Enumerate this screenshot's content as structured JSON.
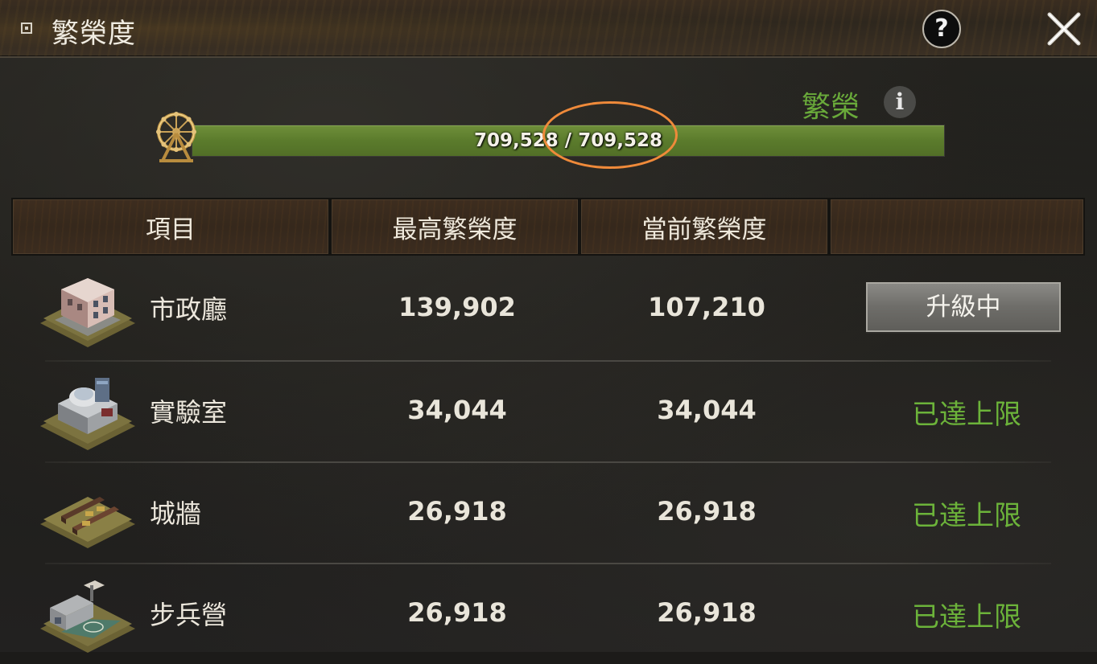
{
  "window": {
    "title": "繁榮度",
    "help_label": "?",
    "colors": {
      "accent_green": "#6cb33a",
      "highlight": "#ef8a3a"
    }
  },
  "prosperity": {
    "status": "繁榮",
    "info_label": "i",
    "current": "709,528",
    "max": "709,528",
    "text": "709,528 / 709,528",
    "fill_fraction": 1.0
  },
  "table": {
    "headers": [
      "項目",
      "最高繁榮度",
      "當前繁榮度",
      ""
    ],
    "rows": [
      {
        "name": "市政廳",
        "max": "139,902",
        "current": "107,210",
        "status": "升級中",
        "icon": "town-hall-icon"
      },
      {
        "name": "實驗室",
        "max": "34,044",
        "current": "34,044",
        "status": "已達上限",
        "icon": "laboratory-icon"
      },
      {
        "name": "城牆",
        "max": "26,918",
        "current": "26,918",
        "status": "已達上限",
        "icon": "city-wall-icon"
      },
      {
        "name": "步兵營",
        "max": "26,918",
        "current": "26,918",
        "status": "已達上限",
        "icon": "infantry-barracks-icon"
      }
    ]
  }
}
